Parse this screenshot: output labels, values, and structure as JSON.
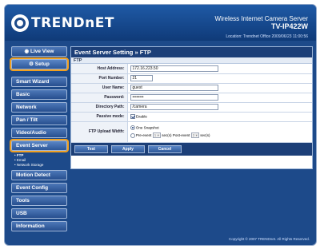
{
  "header": {
    "brand": "TRENDnET",
    "product_name": "Wireless Internet Camera Server",
    "model": "TV-IP422W",
    "location": "Location: Trendnet Office   2009/06/23 11:00:56"
  },
  "sidebar": {
    "live_view": "Live View",
    "setup": "Setup",
    "items": [
      {
        "label": "Smart Wizard"
      },
      {
        "label": "Basic"
      },
      {
        "label": "Network"
      },
      {
        "label": "Pan / Tilt"
      },
      {
        "label": "Video/Audio"
      },
      {
        "label": "Event Server"
      },
      {
        "label": "Motion Detect"
      },
      {
        "label": "Event Config"
      },
      {
        "label": "Tools"
      },
      {
        "label": "USB"
      },
      {
        "label": "Information"
      }
    ],
    "event_sub": [
      "• FTP",
      "• Email",
      "• Network Storage"
    ]
  },
  "main": {
    "title": "Event Server Setting » FTP",
    "section": "FTP",
    "fields": {
      "host_label": "Host Address:",
      "host_value": "172.16.223.50",
      "port_label": "Port Number:",
      "port_value": "21",
      "user_label": "User Name:",
      "user_value": "guest",
      "pass_label": "Password:",
      "pass_value": "••••••••",
      "dir_label": "Directory Path:",
      "dir_value": "/camera",
      "passive_label": "Passive mode:",
      "passive_value": "Enable",
      "upload_label": "FTP Upload Width:",
      "one_snapshot": "One Snapshot",
      "pre_event": "Pre-event",
      "pre_value": "1",
      "secs1": "sec(s)",
      "post_event": "Post-event",
      "post_value": "2",
      "secs2": "sec(s)"
    },
    "buttons": {
      "test": "Test",
      "apply": "Apply",
      "cancel": "Cancel"
    }
  },
  "footer": {
    "copyright": "Copyright © 2007 TRENDnet. All Rights Reserved."
  },
  "colors": {
    "frame": "#1d4a8a",
    "highlight": "#f0a020",
    "button": "#2d5799"
  }
}
